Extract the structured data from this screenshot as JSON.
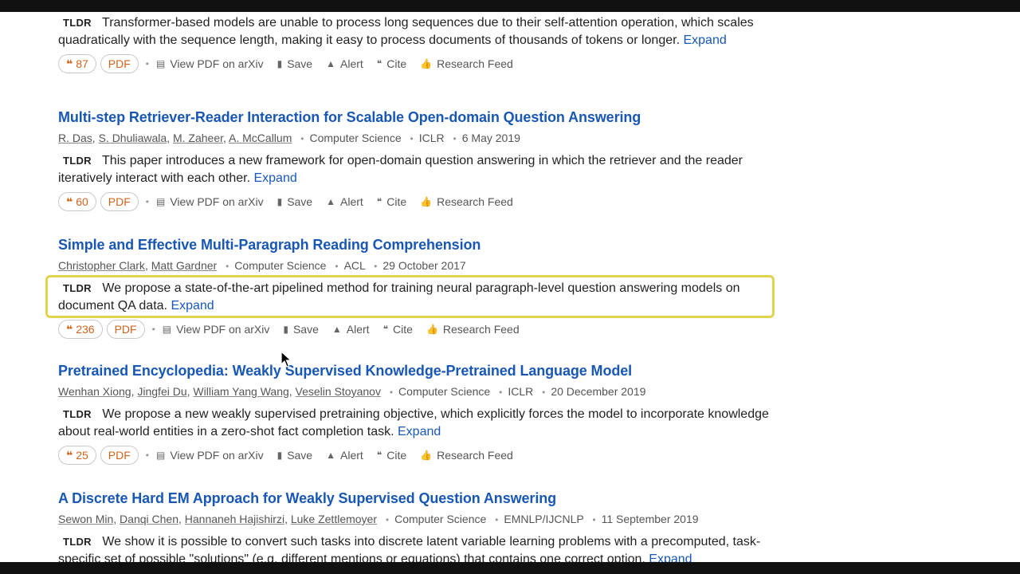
{
  "ui": {
    "tldr_badge": "TLDR",
    "expand_label": "Expand",
    "view_pdf_label": "View PDF on arXiv",
    "save_label": "Save",
    "alert_label": "Alert",
    "cite_label": "Cite",
    "research_feed_label": "Research Feed",
    "pdf_label": "PDF",
    "colors": {
      "title": "#1857b6",
      "citation": "#d0631c",
      "highlight": "#e2d34c"
    },
    "icons": [
      "quote-icon",
      "pdf-file-icon",
      "bookmark-icon",
      "bell-icon",
      "cite-icon",
      "thumbs-up-icon",
      "cursor-arrow-icon"
    ]
  },
  "results": [
    {
      "tldr": "Transformer-based models are unable to process long sequences due to their self-attention operation, which scales quadratically with the sequence length, making it easy to process documents of thousands of tokens or longer.",
      "citations": "87"
    },
    {
      "title": "Multi-step Retriever-Reader Interaction for Scalable Open-domain Question Answering",
      "authors": [
        "R. Das",
        "S. Dhuliawala",
        "M. Zaheer",
        "A. McCallum"
      ],
      "field": "Computer Science",
      "venue": "ICLR",
      "date": "6 May 2019",
      "tldr": "This paper introduces a new framework for open-domain question answering in which the retriever and the reader iteratively interact with each other.",
      "citations": "60"
    },
    {
      "title": "Simple and Effective Multi-Paragraph Reading Comprehension",
      "authors": [
        "Christopher Clark",
        "Matt Gardner"
      ],
      "field": "Computer Science",
      "venue": "ACL",
      "date": "29 October 2017",
      "tldr": "We propose a state-of-the-art pipelined method for training neural paragraph-level question answering models on document QA data.",
      "citations": "236"
    },
    {
      "title": "Pretrained Encyclopedia: Weakly Supervised Knowledge-Pretrained Language Model",
      "authors": [
        "Wenhan Xiong",
        "Jingfei Du",
        "William Yang Wang",
        "Veselin Stoyanov"
      ],
      "field": "Computer Science",
      "venue": "ICLR",
      "date": "20 December 2019",
      "tldr": "We propose a new weakly supervised pretraining objective, which explicitly forces the model to incorporate knowledge about real-world entities in a zero-shot fact completion task.",
      "citations": "25"
    },
    {
      "title": "A Discrete Hard EM Approach for Weakly Supervised Question Answering",
      "authors": [
        "Sewon Min",
        "Danqi Chen",
        "Hannaneh Hajishirzi",
        "Luke Zettlemoyer"
      ],
      "field": "Computer Science",
      "venue": "EMNLP/IJCNLP",
      "date": "11 September 2019",
      "tldr": "We show it is possible to convert such tasks into discrete latent variable learning problems with a precomputed, task-specific set of possible \"solutions\" (e.g. different mentions or equations) that contains one correct option."
    }
  ]
}
